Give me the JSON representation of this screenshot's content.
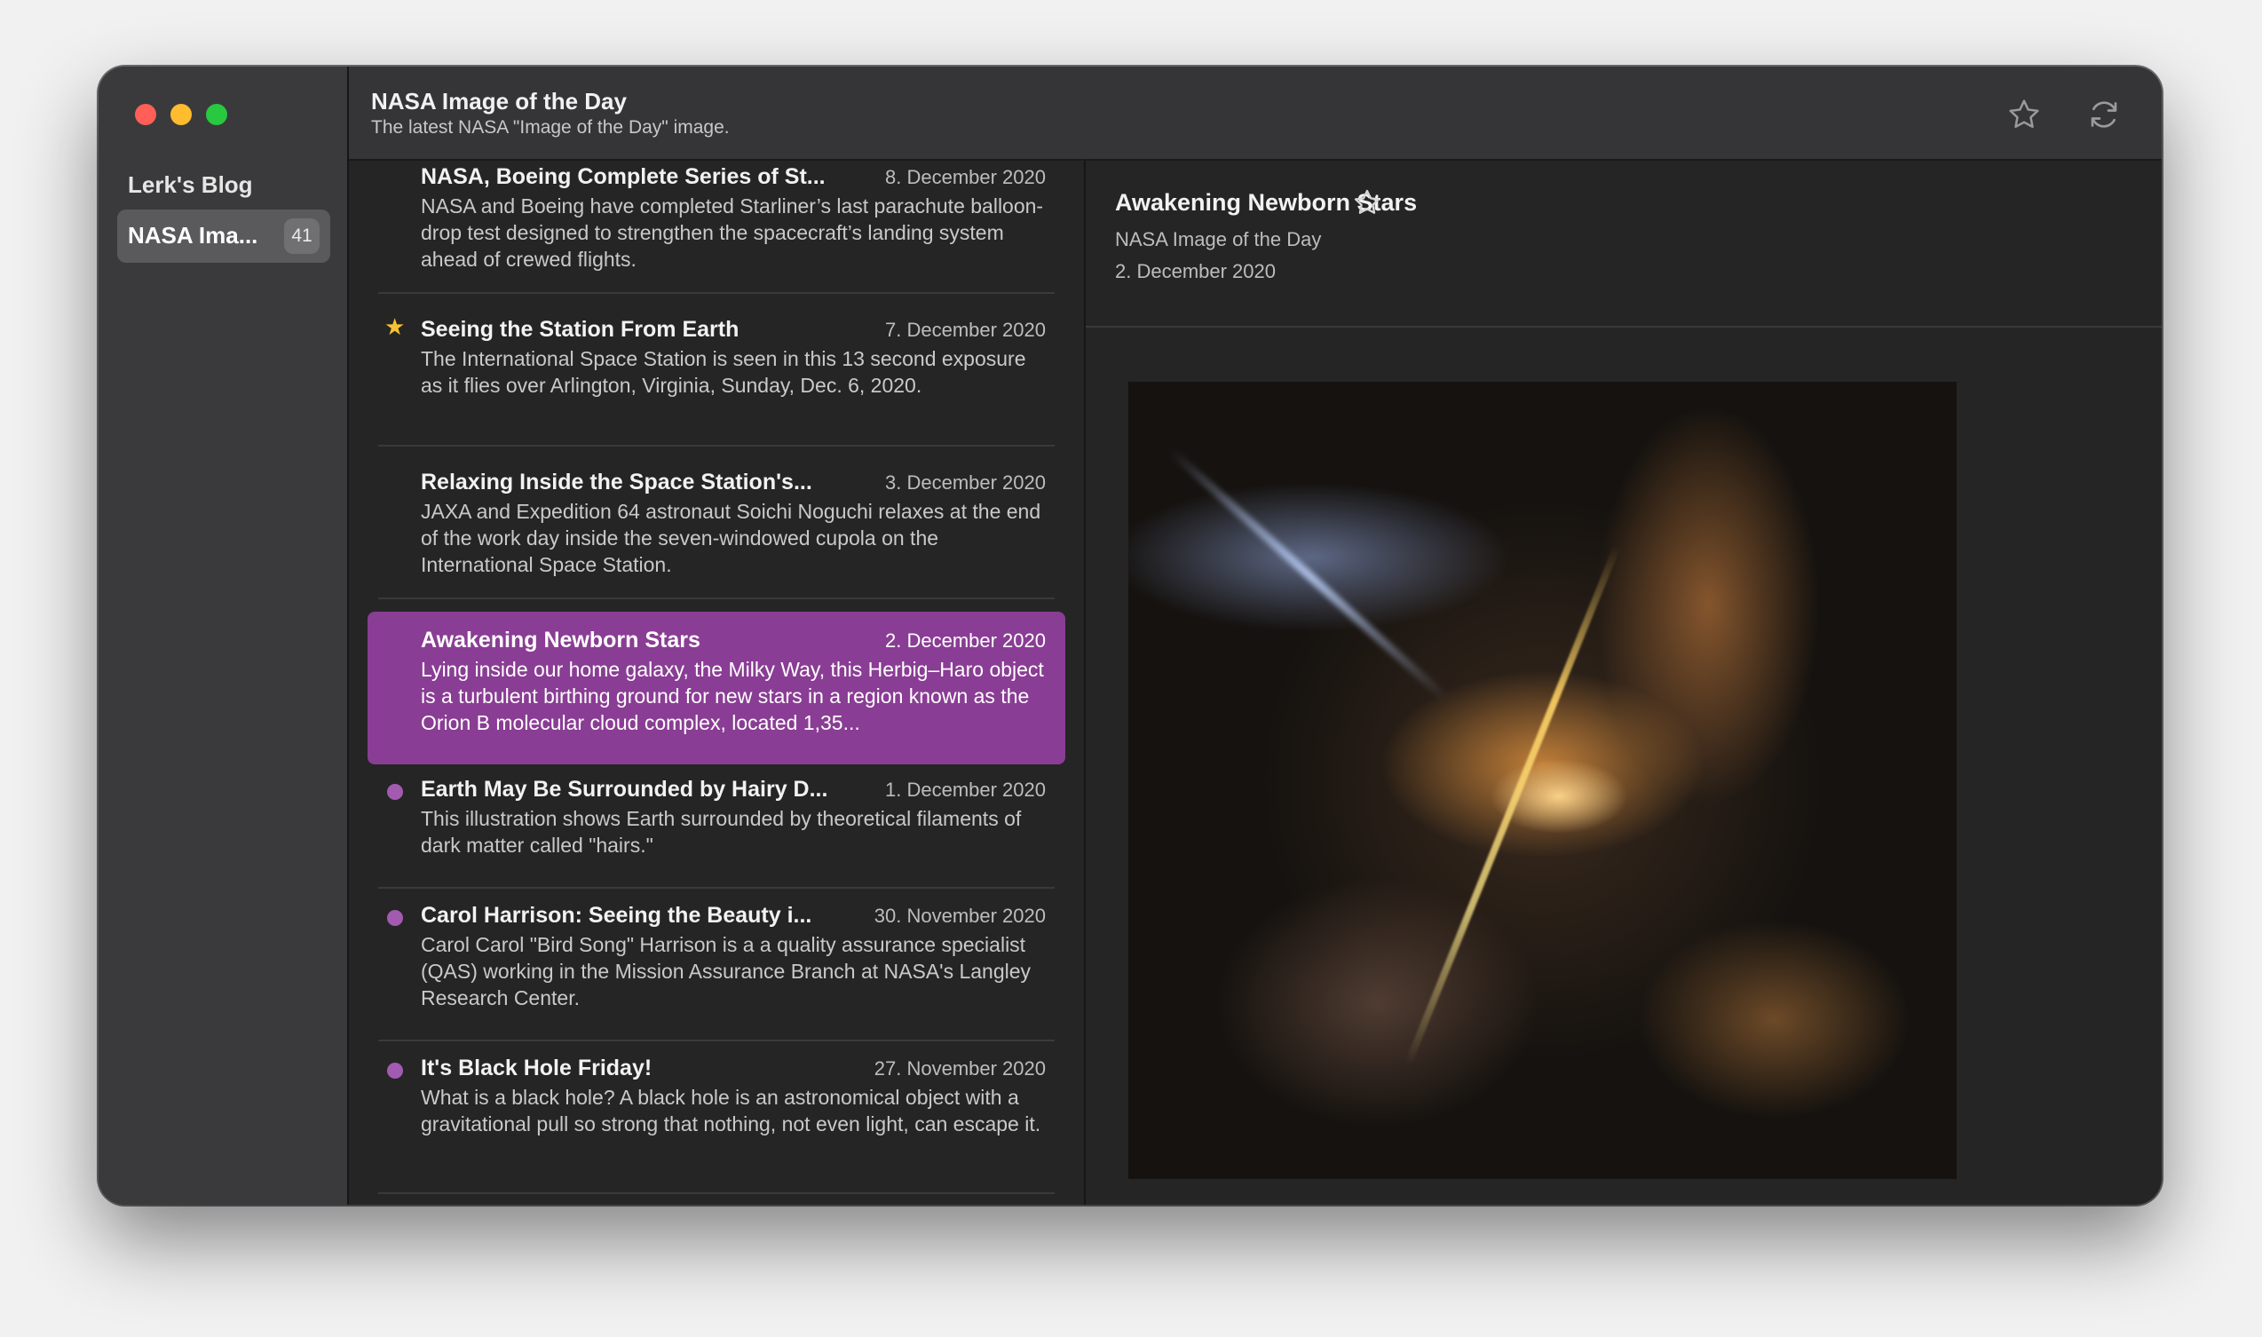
{
  "sidebar": {
    "group_label": "Lerk's Blog",
    "items": [
      {
        "label": "NASA Ima...",
        "count": "41",
        "selected": true
      }
    ]
  },
  "header": {
    "title": "NASA Image of the Day",
    "subtitle": "The latest NASA \"Image of the Day\" image.",
    "icons": [
      "star-icon",
      "refresh-icon"
    ]
  },
  "articles": [
    {
      "title": "NASA, Boeing Complete Series of St...",
      "date": "8. December 2020",
      "summary": "NASA and Boeing have completed Starliner’s last parachute balloon-drop test designed to strengthen the spacecraft’s landing system ahead of crewed flights.",
      "status": "read"
    },
    {
      "title": "Seeing the Station From Earth",
      "date": "7. December 2020",
      "summary": "The International Space Station is seen in this 13 second exposure as it flies over Arlington, Virginia, Sunday, Dec. 6, 2020.",
      "status": "starred"
    },
    {
      "title": "Relaxing Inside the Space Station's...",
      "date": "3. December 2020",
      "summary": "JAXA and Expedition 64 astronaut Soichi Noguchi relaxes at the end of the work day inside the seven-windowed cupola on the International Space Station.",
      "status": "read"
    },
    {
      "title": "Awakening Newborn Stars",
      "date": "2. December 2020",
      "summary": "Lying inside our home galaxy, the Milky Way, this Herbig–Haro object is a turbulent birthing ground for new stars in a region known as the Orion B molecular cloud complex, located 1,35...",
      "status": "selected"
    },
    {
      "title": "Earth May Be Surrounded by Hairy D...",
      "date": "1. December 2020",
      "summary": "This illustration shows Earth surrounded by theoretical filaments of dark matter called \"hairs.\"",
      "status": "unread"
    },
    {
      "title": "Carol Harrison: Seeing the Beauty i...",
      "date": "30. November 2020",
      "summary": "Carol Carol \"Bird Song\" Harrison is a a quality assurance specialist (QAS) working in the Mission Assurance Branch at NASA's Langley Research Center.",
      "status": "unread"
    },
    {
      "title": "It's Black Hole Friday!",
      "date": "27. November 2020",
      "summary": "What is a black hole? A black hole is an astronomical object with a gravitational pull so strong that nothing, not even light, can escape it.",
      "status": "unread"
    }
  ],
  "detail": {
    "title": "Awakening Newborn Stars",
    "feed": "NASA Image of the Day",
    "date": "2. December 2020",
    "image_subject": "herbig-haro-nebula-image"
  },
  "colors": {
    "accent": "#8a3d94",
    "unread_dot": "#a25bb0",
    "star": "#f7c232"
  }
}
